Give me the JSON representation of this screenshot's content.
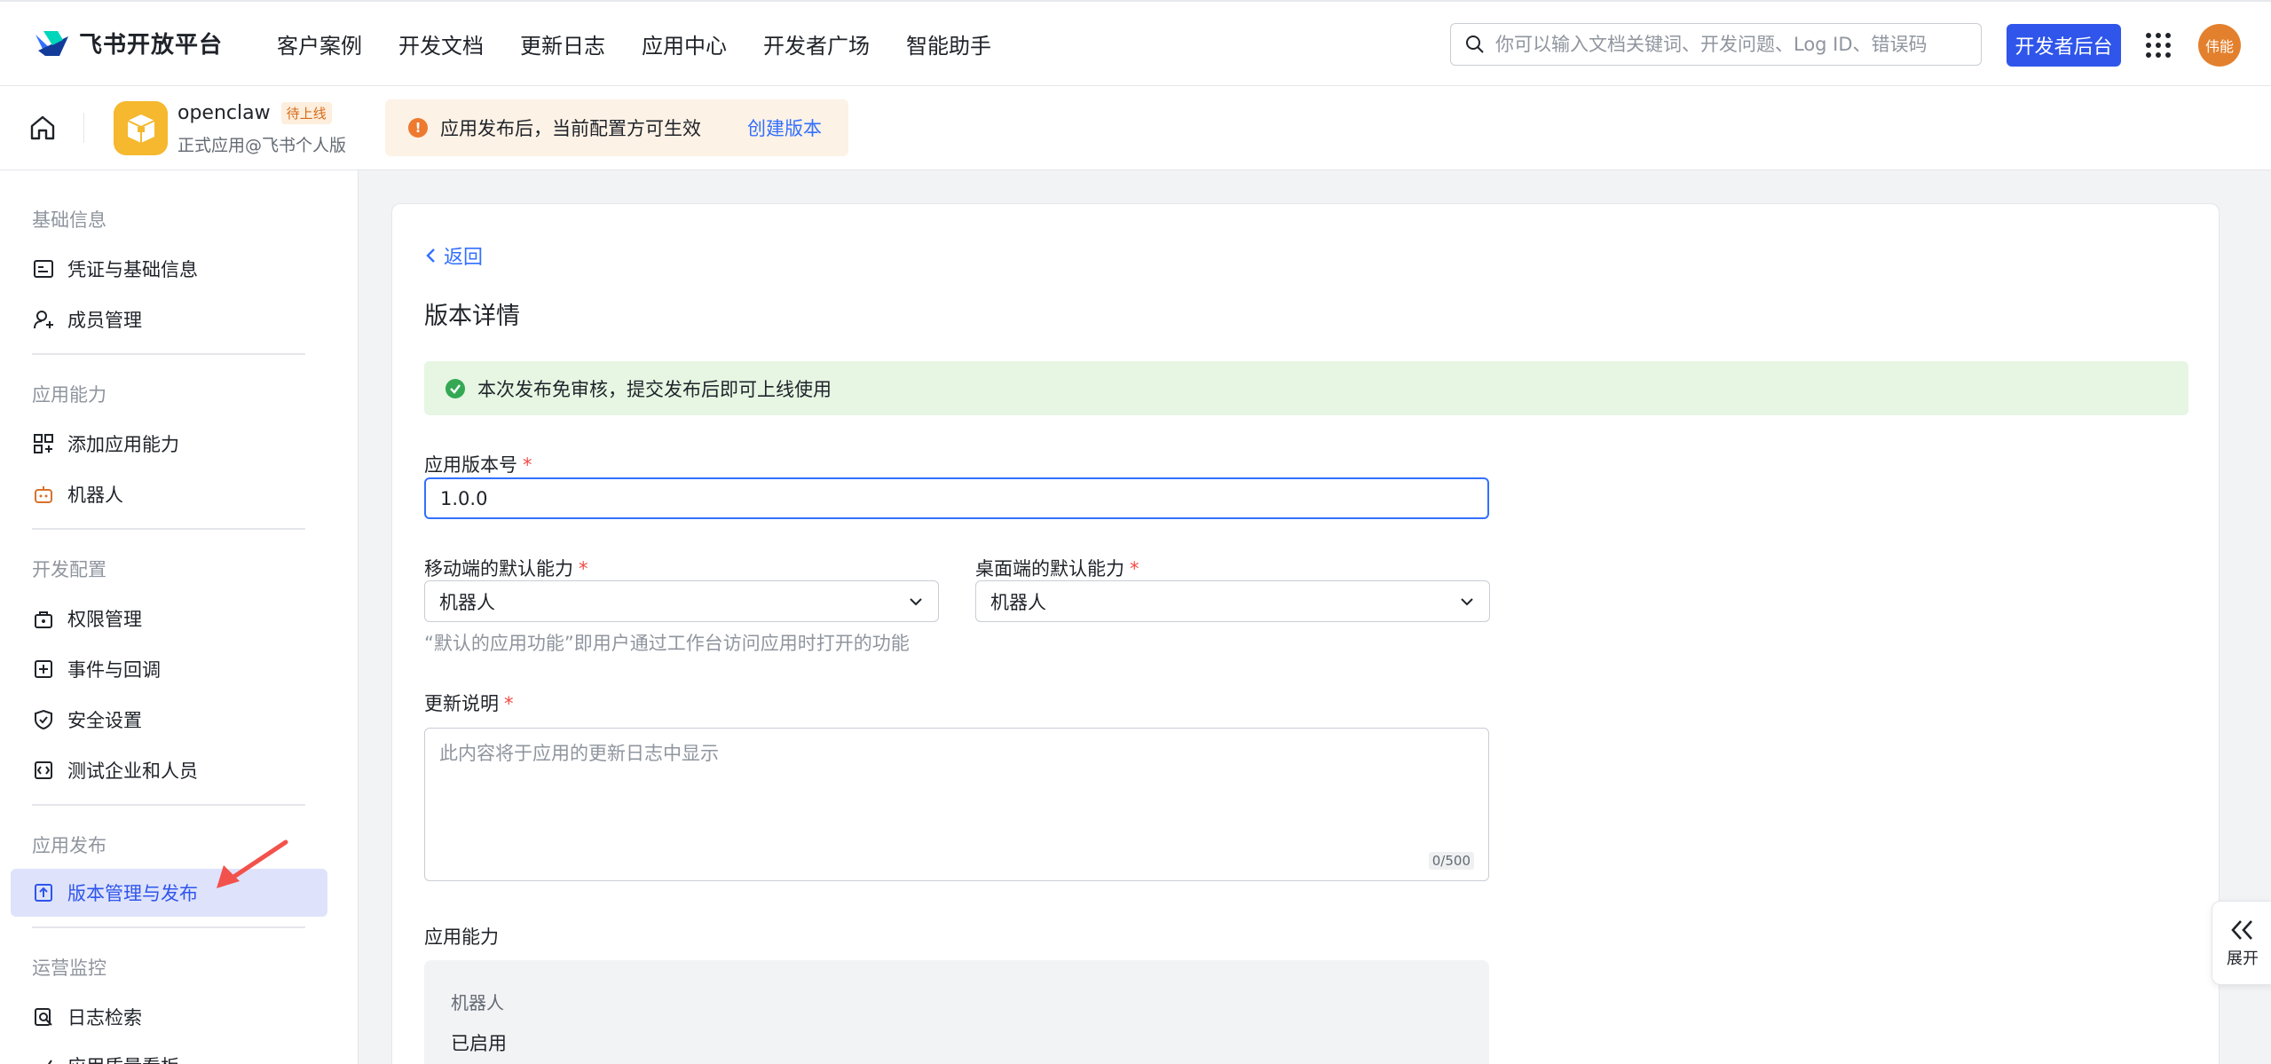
{
  "brand": {
    "name": "飞书开放平台"
  },
  "nav": {
    "items": [
      "客户案例",
      "开发文档",
      "更新日志",
      "应用中心",
      "开发者广场",
      "智能助手"
    ],
    "search_placeholder": "你可以输入文档关键词、开发问题、Log ID、错误码",
    "dev_console": "开发者后台",
    "avatar_text": "伟能"
  },
  "app": {
    "name": "openclaw",
    "status": "待上线",
    "subtitle": "正式应用@飞书个人版",
    "notice": "应用发布后，当前配置方可生效",
    "notice_action": "创建版本"
  },
  "sidebar": {
    "sections": [
      {
        "title": "基础信息",
        "items": [
          "凭证与基础信息",
          "成员管理"
        ]
      },
      {
        "title": "应用能力",
        "items": [
          "添加应用能力",
          "机器人"
        ]
      },
      {
        "title": "开发配置",
        "items": [
          "权限管理",
          "事件与回调",
          "安全设置",
          "测试企业和人员"
        ]
      },
      {
        "title": "应用发布",
        "items": [
          "版本管理与发布"
        ]
      },
      {
        "title": "运营监控",
        "items": [
          "日志检索",
          "应用质量看板"
        ]
      }
    ],
    "active_item": "版本管理与发布"
  },
  "main": {
    "back": "返回",
    "title": "版本详情",
    "success_notice": "本次发布免审核，提交发布后即可上线使用",
    "version_label": "应用版本号",
    "version_value": "1.0.0",
    "mobile_label": "移动端的默认能力",
    "mobile_value": "机器人",
    "desktop_label": "桌面端的默认能力",
    "desktop_value": "机器人",
    "default_hint": "“默认的应用功能”即用户通过工作台访问应用时打开的功能",
    "update_label": "更新说明",
    "update_placeholder": "此内容将于应用的更新日志中显示",
    "update_counter": "0/500",
    "ability_label": "应用能力",
    "ability_name": "机器人",
    "ability_status": "已启用"
  },
  "expand": {
    "label": "展开"
  },
  "colors": {
    "primary": "#2f55eb",
    "link": "#3370ff",
    "success_bg": "#e6f6e3",
    "warning_bg": "#fdf2e6",
    "active_bg": "#dee3fb",
    "annotation_arrow": "#f2524b"
  }
}
